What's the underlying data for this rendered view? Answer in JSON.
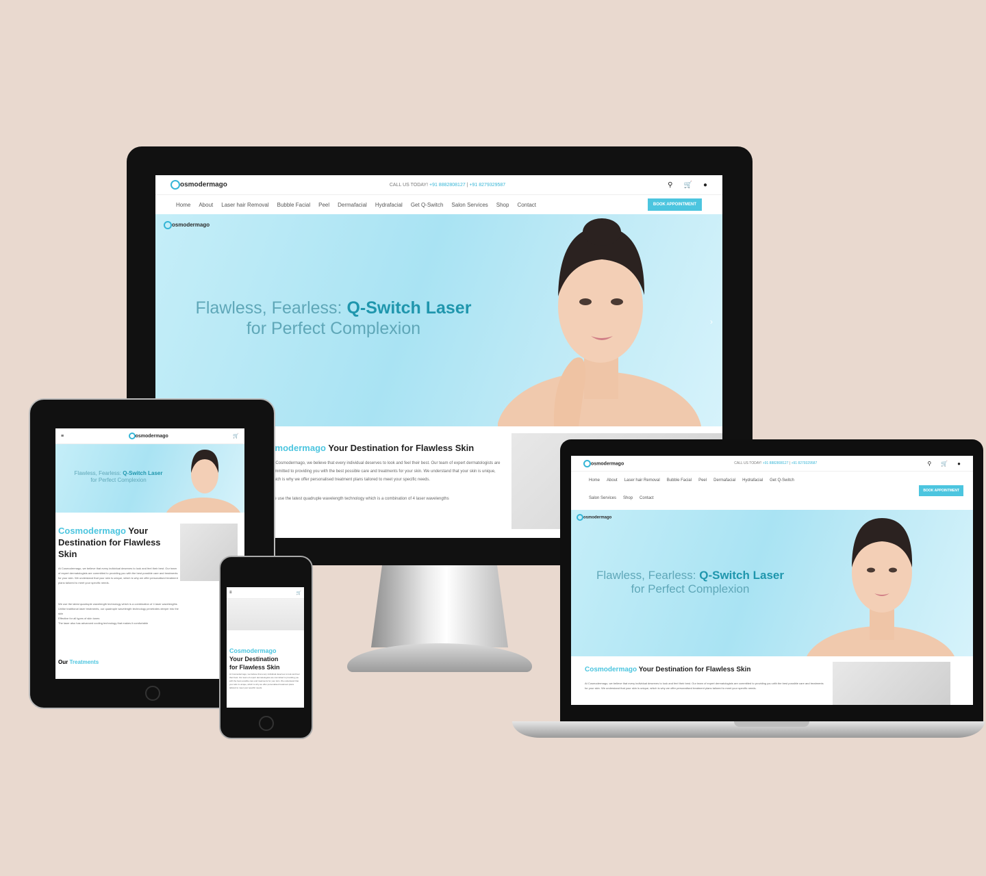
{
  "site": {
    "brand": "Cosmodermago",
    "logo_text": "osmodermago",
    "call_label": "CALL US TODAY!",
    "phone_1": "+91 8882808127",
    "phone_2": "+91 8279329587",
    "book_button": "BOOK APPOINTMENT"
  },
  "nav": {
    "items": [
      "Home",
      "About",
      "Laser hair Removal",
      "Bubble Facial",
      "Peel",
      "Dermafacial",
      "Hydrafacial",
      "Get Q-Switch",
      "Salon Services",
      "Shop",
      "Contact"
    ]
  },
  "hero": {
    "line1_plain": "Flawless, Fearless: ",
    "line1_bold": "Q-Switch Laser",
    "line2": "for Perfect Complexion"
  },
  "about": {
    "brand": "Cosmodermago",
    "heading": "Your Destination for Flawless Skin",
    "heading_tablet_1": "Your",
    "heading_tablet_2": "Destination for Flawless",
    "heading_tablet_3": "Skin",
    "heading_phone_1": "Your Destination",
    "heading_phone_2": "for Flawless Skin",
    "body_1": "At Cosmodermago, we believe that every individual deserves to look and feel their best. Our team of expert dermatologists are committed to providing you with the best possible care and treatments for your skin. We understand that your skin is unique, which is why we offer personalised treatment plans tailored to meet your specific needs.",
    "body_2": "We use the latest quadruple wavelength technology which is a combination of 4 laser wavelengths",
    "tablet_section_prefix": "Our",
    "tablet_section_suffix": "Treatments",
    "tablet_bullets": [
      "We use the latest quadruple wavelength technology which is a combination of 4 laser wavelengths",
      "Unlike traditional laser treatments, our quadruple wavelength technology penetrates deeper into the skin",
      "Effective for all types of skin tones",
      "The laser also has advanced cooling technology that makes it comfortable"
    ]
  },
  "icons": {
    "search": "search-icon",
    "cart": "cart-icon",
    "user": "user-icon",
    "menu": "menu-icon"
  },
  "colors": {
    "background": "#e9d9cf",
    "accent": "#4cc5df",
    "hero_bold": "#1f96ad",
    "hero_plain": "#5fa7b8"
  }
}
